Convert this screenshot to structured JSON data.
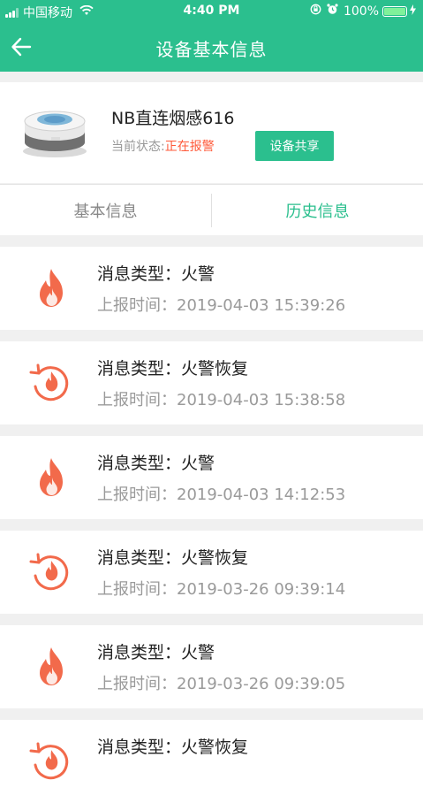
{
  "status_bar": {
    "carrier": "中国移动",
    "time": "4:40 PM",
    "battery": "100%"
  },
  "nav": {
    "title": "设备基本信息"
  },
  "device": {
    "name": "NB直连烟感616",
    "status_label": "当前状态:",
    "status_value": "正在报警",
    "share_label": "设备共享"
  },
  "tabs": {
    "basic": "基本信息",
    "history": "历史信息"
  },
  "messages": [
    {
      "type_label": "消息类型：",
      "type_value": "火警",
      "time_label": "上报时间：",
      "time_value": "2019-04-03 15:39:26",
      "icon": "fire-icon"
    },
    {
      "type_label": "消息类型：",
      "type_value": "火警恢复",
      "time_label": "上报时间：",
      "time_value": "2019-04-03 15:38:58",
      "icon": "fire-restore-icon"
    },
    {
      "type_label": "消息类型：",
      "type_value": "火警",
      "time_label": "上报时间：",
      "time_value": "2019-04-03 14:12:53",
      "icon": "fire-icon"
    },
    {
      "type_label": "消息类型：",
      "type_value": "火警恢复",
      "time_label": "上报时间：",
      "time_value": "2019-03-26 09:39:14",
      "icon": "fire-restore-icon"
    },
    {
      "type_label": "消息类型：",
      "type_value": "火警",
      "time_label": "上报时间：",
      "time_value": "2019-03-26 09:39:05",
      "icon": "fire-icon"
    },
    {
      "type_label": "消息类型：",
      "type_value": "火警恢复",
      "time_label": "",
      "time_value": "",
      "icon": "fire-restore-icon"
    }
  ],
  "colors": {
    "accent": "#2bbf8e",
    "alarm": "#ff5a3a",
    "fire": "#f26a4b"
  }
}
